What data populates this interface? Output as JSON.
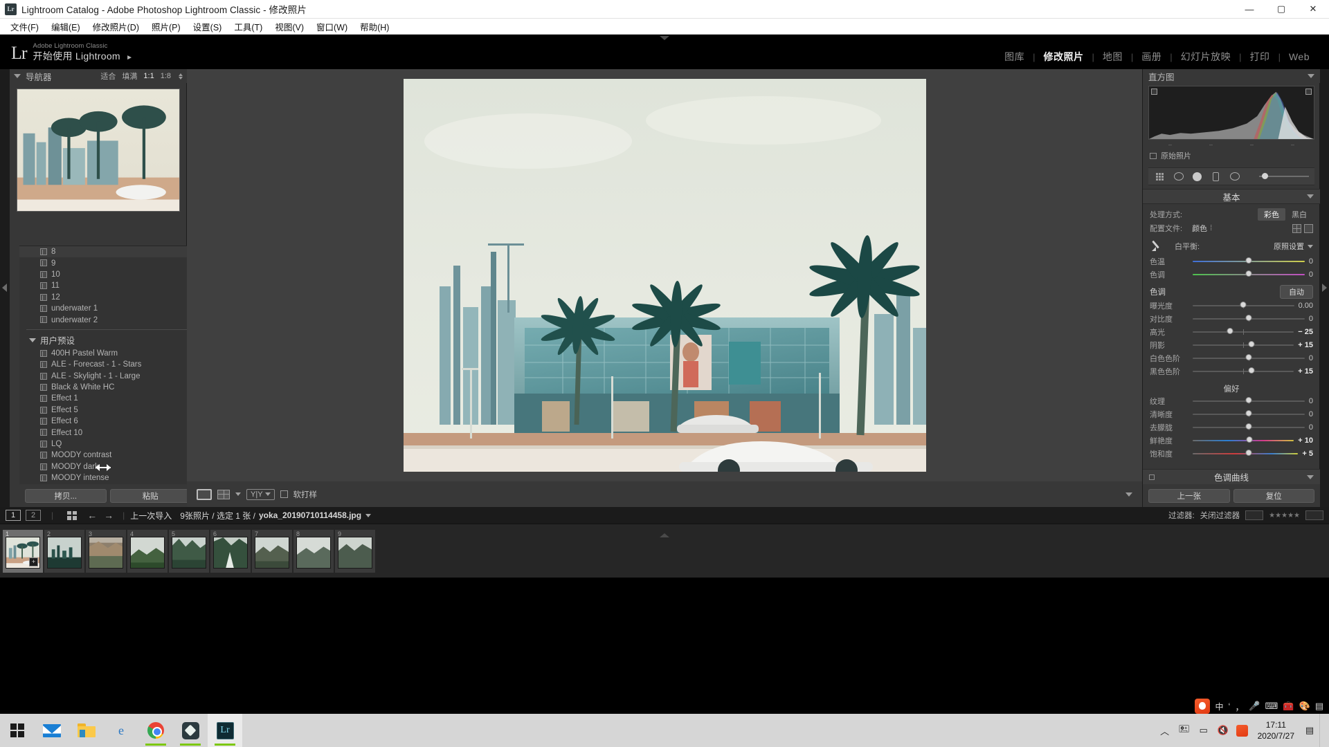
{
  "window": {
    "title": "Lightroom Catalog - Adobe Photoshop Lightroom Classic - 修改照片",
    "app_icon": "Lr",
    "minimize": "—",
    "maximize": "▢",
    "close": "✕"
  },
  "menubar": {
    "items": [
      "文件(F)",
      "编辑(E)",
      "修改照片(D)",
      "照片(P)",
      "设置(S)",
      "工具(T)",
      "视图(V)",
      "窗口(W)",
      "帮助(H)"
    ]
  },
  "identity": {
    "logo": "Lr",
    "line1": "Adobe Lightroom Classic",
    "line2": "开始使用 Lightroom",
    "arrow": "►"
  },
  "modules": {
    "items": [
      "图库",
      "修改照片",
      "地图",
      "画册",
      "幻灯片放映",
      "打印",
      "Web"
    ],
    "active": "修改照片",
    "separator": "|"
  },
  "navigator": {
    "title": "导航器",
    "zoom_fit": "适合",
    "zoom_fill": "填满",
    "zoom_1to1": "1:1",
    "zoom_ratio": "1:8"
  },
  "presets": {
    "top_items": [
      "8",
      "9",
      "10",
      "11",
      "12",
      "underwater 1",
      "underwater 2"
    ],
    "group_label": "用户预设",
    "user_items": [
      "400H Pastel Warm",
      "ALE - Forecast - 1 - Stars",
      "ALE - Skylight - 1 - Large",
      "Black & White HC",
      "Effect 1",
      "Effect 5",
      "Effect 6",
      "Effect 10",
      "LQ",
      "MOODY contrast",
      "MOODY dark",
      "MOODY intense"
    ]
  },
  "left_buttons": {
    "copy": "拷贝...",
    "paste": "粘贴"
  },
  "center_toolbar": {
    "view_loupe": "loupe-view-icon",
    "view_compare": "compare-view-icon",
    "view_yy": "Y|Y",
    "softproof_label": "软打样",
    "softproof_checked": false
  },
  "histogram": {
    "title": "直方图",
    "raw_label": "原始照片"
  },
  "tools": {
    "crop": "crop-tool-icon",
    "heal": "spot-removal-icon",
    "redeye": "red-eye-icon",
    "grad": "graduated-filter-icon",
    "radial": "radial-filter-icon",
    "brush": "adjustment-brush-icon"
  },
  "basic": {
    "section_title": "基本",
    "treatment_label": "处理方式:",
    "treatment_color": "彩色",
    "treatment_bw": "黑白",
    "treatment_selected": "彩色",
    "profile_label": "配置文件:",
    "profile_value": "颜色",
    "wb_label": "白平衡:",
    "wb_value": "原照设置",
    "temp_label": "色温",
    "temp_value": "0",
    "tint_label": "色调",
    "tint_value": "0",
    "tone_label": "色调",
    "auto_label": "自动",
    "sliders": [
      {
        "label": "曝光度",
        "value": "0.00",
        "pos": 50
      },
      {
        "label": "对比度",
        "value": "0",
        "pos": 50
      },
      {
        "label": "高光",
        "value": "− 25",
        "pos": 37
      },
      {
        "label": "阴影",
        "value": "+ 15",
        "pos": 58
      },
      {
        "label": "白色色阶",
        "value": "0",
        "pos": 50
      },
      {
        "label": "黑色色阶",
        "value": "+ 15",
        "pos": 58
      }
    ],
    "presence_label": "偏好",
    "presence_sliders": [
      {
        "label": "纹理",
        "value": "0",
        "pos": 50,
        "track": ""
      },
      {
        "label": "清晰度",
        "value": "0",
        "pos": 50,
        "track": ""
      },
      {
        "label": "去朦胧",
        "value": "0",
        "pos": 50,
        "track": ""
      },
      {
        "label": "鲜艳度",
        "value": "+ 10",
        "pos": 56,
        "track": "vib"
      },
      {
        "label": "饱和度",
        "value": "+ 5",
        "pos": 53,
        "track": "sat"
      }
    ]
  },
  "tone_curve": {
    "title": "色调曲线"
  },
  "right_buttons": {
    "previous": "上一张",
    "reset": "复位"
  },
  "filmstrip": {
    "page1": "1",
    "page2": "2",
    "grid_icon": "grid-view-icon",
    "back_arrow": "←",
    "forward_arrow": "→",
    "source": "上一次导入",
    "count": "9张照片 / 选定 1 张 /",
    "filename": "yoka_20190710114458.jpg",
    "filter_label": "过滤器:",
    "filter_value": "关闭过滤器",
    "thumbs": [
      "1",
      "2",
      "3",
      "4",
      "5",
      "6",
      "7",
      "8",
      "9"
    ],
    "selected_index": 0,
    "badge": "+"
  },
  "ime": {
    "lang": "中",
    "mode": "ʻ",
    "icons": [
      "mic-icon",
      "keyboard-icon",
      "toolbox-icon",
      "skin-icon",
      "menu-icon"
    ]
  },
  "taskbar": {
    "apps": [
      "start-button",
      "mail-app",
      "file-explorer",
      "edge-browser",
      "chrome-browser",
      "note-app",
      "lightroom-app"
    ],
    "active_app": "lightroom-app",
    "clock_time": "17:11",
    "clock_date": "2020/7/27",
    "notification": "notification-icon",
    "tray": [
      "show-hidden-icons",
      "usb-icon",
      "battery-icon",
      "volume-icon",
      "sogou-icon"
    ]
  },
  "colors": {
    "panel_bg": "#373737",
    "canvas_bg": "#404040",
    "accent": "#7fd4e8",
    "taskbar": "#d6d6d6"
  }
}
